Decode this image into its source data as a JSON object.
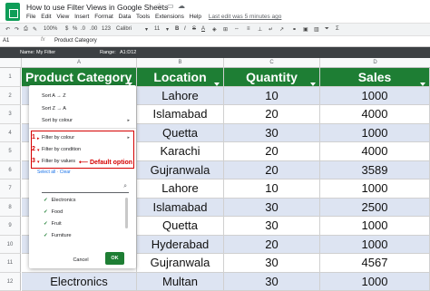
{
  "app": {
    "title": "How to use Filter Views in Google Sheets",
    "menu": [
      "File",
      "Edit",
      "View",
      "Insert",
      "Format",
      "Data",
      "Tools",
      "Extensions",
      "Help"
    ],
    "last_edit": "Last edit was 5 minutes ago"
  },
  "toolbar": {
    "zoom": "100%",
    "currency": "$",
    "percent": "%",
    "decimals_less": ".0",
    "decimals_more": ".00",
    "number_format": "123",
    "font": "Calibri",
    "font_size": "11",
    "bold": "B",
    "italic": "I",
    "strike": "S",
    "text_color": "A"
  },
  "formula_bar": {
    "cell_ref": "A1",
    "fx": "fx",
    "value": "Product Category"
  },
  "filter_view": {
    "name_label": "Name:",
    "name": "My Filter",
    "range_label": "Range:",
    "range": "A1:D12"
  },
  "columns": [
    "A",
    "B",
    "C",
    "D"
  ],
  "rows": [
    "1",
    "2",
    "3",
    "4",
    "5",
    "6",
    "7",
    "8",
    "9",
    "10",
    "11",
    "12"
  ],
  "table": {
    "headers": [
      "Product Category",
      "Location",
      "Quantity",
      "Sales"
    ],
    "rows": [
      [
        "",
        "Lahore",
        "10",
        "1000"
      ],
      [
        "",
        "Islamabad",
        "20",
        "4000"
      ],
      [
        "",
        "Quetta",
        "30",
        "1000"
      ],
      [
        "",
        "Karachi",
        "20",
        "4000"
      ],
      [
        "",
        "Gujranwala",
        "20",
        "3589"
      ],
      [
        "",
        "Lahore",
        "10",
        "1000"
      ],
      [
        "",
        "Islamabad",
        "30",
        "2500"
      ],
      [
        "",
        "Quetta",
        "30",
        "1000"
      ],
      [
        "",
        "Hyderabad",
        "20",
        "1000"
      ],
      [
        "",
        "Gujranwala",
        "30",
        "4567"
      ],
      [
        "Electronics",
        "Multan",
        "30",
        "1000"
      ]
    ]
  },
  "dropdown": {
    "sort_a_z": "Sort A → Z",
    "sort_z_a": "Sort Z → A",
    "sort_by_colour": "Sort by colour",
    "filter_by_colour": "Filter by colour",
    "filter_by_condition": "Filter by condition",
    "filter_by_values": "Filter by values",
    "numbers": [
      "1",
      "2",
      "3"
    ],
    "select_all": "Select all",
    "dot": "·",
    "clear": "Clear",
    "values": [
      "Electronics",
      "Food",
      "Fruit",
      "Furniture"
    ],
    "cancel": "Cancel",
    "ok": "OK"
  },
  "annotation": "Default option",
  "colors": {
    "header_bg": "#1e7e34",
    "band": "#dde4f2",
    "highlight": "#d50000"
  }
}
